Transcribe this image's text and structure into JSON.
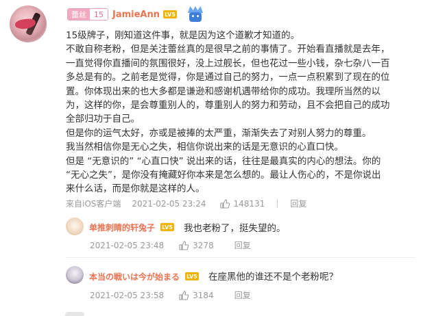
{
  "comment": {
    "fan_badge": {
      "name": "蕾丝",
      "level": "15"
    },
    "username": "JamieAnn",
    "user_level": "LV5",
    "lines": [
      "15级牌子，刚知道这件事，就是因为这个道歉才知道的。",
      "不敢自称老粉，但是关注蕾丝真的是很早之前的事情了。开始看直播就是去年，",
      "一直觉得你直播间的氛围很好，没上过舰长，但也花过一些小钱，杂七杂八一百",
      "多总是有的。之前老是觉得，你是通过自己的努力，一点一点积累到了现在的位",
      "置。你体现出来的也大多都是谦逊和感谢机遇带给你的成功。我理所当然的以",
      "为，这样的你，是会尊重别人的，尊重别人的努力和劳动，且不会把自己的成功",
      "全部归功于自己。",
      "但是你的运气太好，亦或是被捧的太严重，渐渐失去了对别人努力的尊重。",
      "我当然相信你是无心之失，相信你说出来的话是无意识的心直口快。",
      "但是 “无意识的” “心直口快” 说出来的话，往往是最真实的内心的想法。你的",
      "“无心之失”，是你没有掩藏好你本来是怎么想的。最让人伤心的，不是你说出",
      "来什么话，而是你就是这样的人。"
    ],
    "source": "来自iOS客户端",
    "time": "2021-02-05 23:24",
    "likes": "148131",
    "reply_label": "回复"
  },
  "replies": [
    {
      "username": "单推刺睛的轩兔子",
      "user_level": "LV5",
      "text": "我也老粉了，挺失望的。",
      "time": "2021-02-05 23:48",
      "likes": "3278",
      "reply_label": "回复"
    },
    {
      "username": "本当の戦いは今が始まる",
      "user_level": "LV5",
      "text": "在座黑他的谁还不是个老粉呢？",
      "time": "2021-02-05 23:58",
      "likes": "3184",
      "reply_label": "回复"
    }
  ],
  "colors": {
    "username": "#eb7350",
    "fan_badge": "#f0a9bf",
    "level_badge": "#f2b400",
    "meta": "#999999"
  },
  "icons": {
    "like": "thumbs-up-icon",
    "badge": "crown-icon"
  }
}
